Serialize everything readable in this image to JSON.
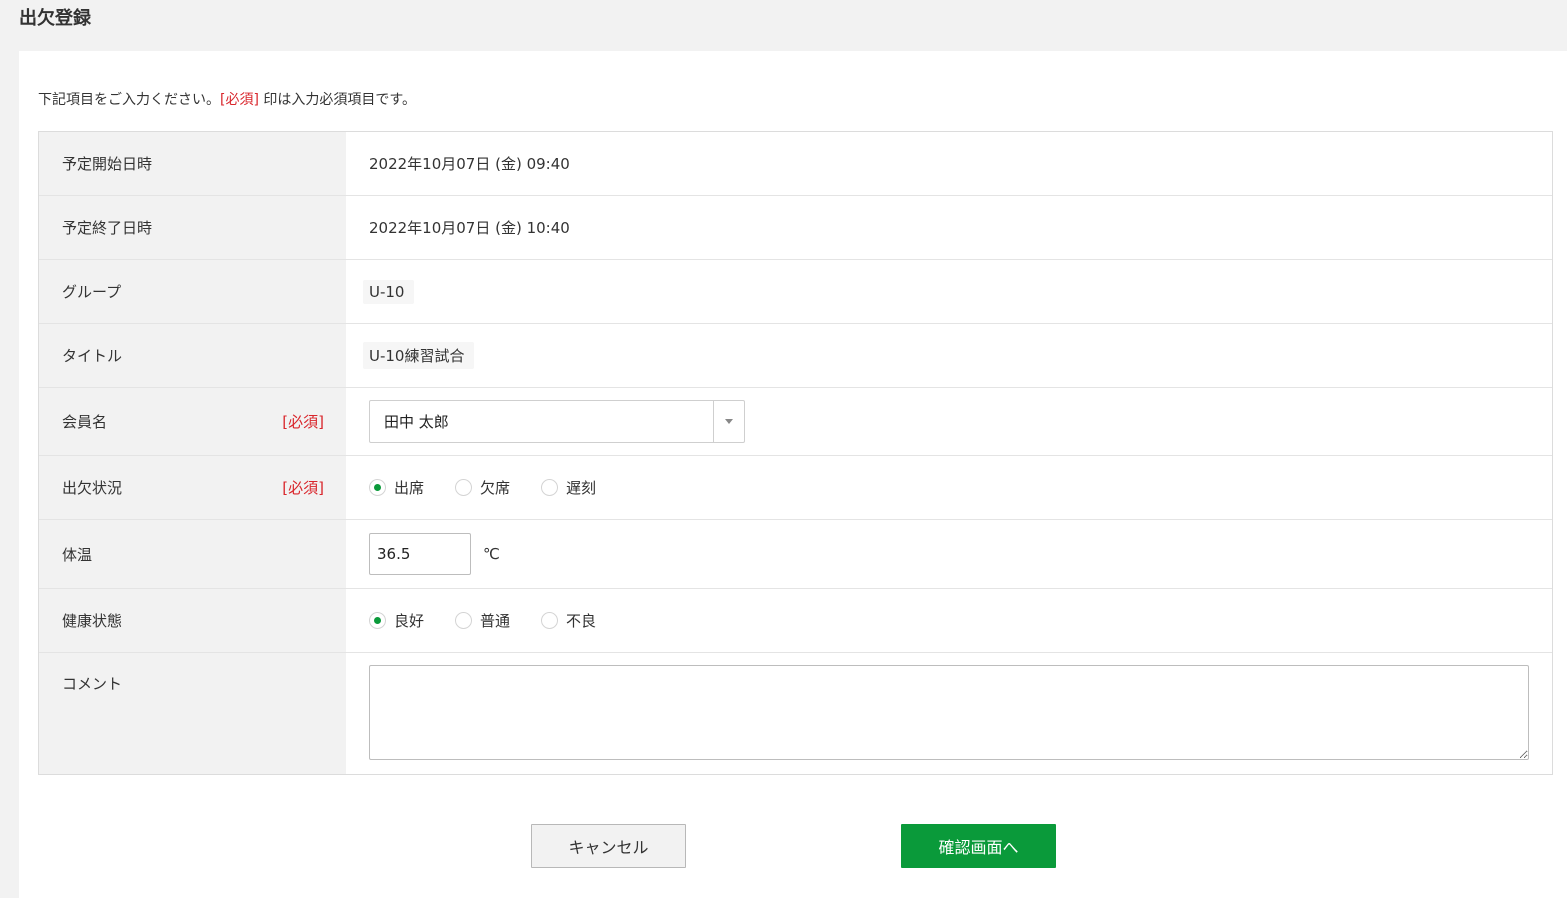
{
  "page": {
    "title": "出欠登録"
  },
  "intro": {
    "prefix": "下記項目をご入力ください。",
    "required_mark": "[必須]",
    "suffix": " 印は入力必須項目です。"
  },
  "form": {
    "start": {
      "label": "予定開始日時",
      "value": "2022年10月07日 (金) 09:40"
    },
    "end": {
      "label": "予定終了日時",
      "value": "2022年10月07日 (金) 10:40"
    },
    "group": {
      "label": "グループ",
      "value": "U-10"
    },
    "title": {
      "label": "タイトル",
      "value": "U-10練習試合"
    },
    "member": {
      "label": "会員名",
      "required": "[必須]",
      "selected": "田中 太郎"
    },
    "attendance": {
      "label": "出欠状況",
      "required": "[必須]",
      "options": [
        "出席",
        "欠席",
        "遅刻"
      ],
      "selected": "出席"
    },
    "temperature": {
      "label": "体温",
      "value": "36.5",
      "unit": "℃"
    },
    "health": {
      "label": "健康状態",
      "options": [
        "良好",
        "普通",
        "不良"
      ],
      "selected": "良好"
    },
    "comment": {
      "label": "コメント",
      "value": ""
    }
  },
  "buttons": {
    "cancel": "キャンセル",
    "confirm": "確認画面へ"
  },
  "colors": {
    "accent": "#0a9a3a",
    "required": "#d9262c",
    "label_bg": "#f2f2f2"
  }
}
